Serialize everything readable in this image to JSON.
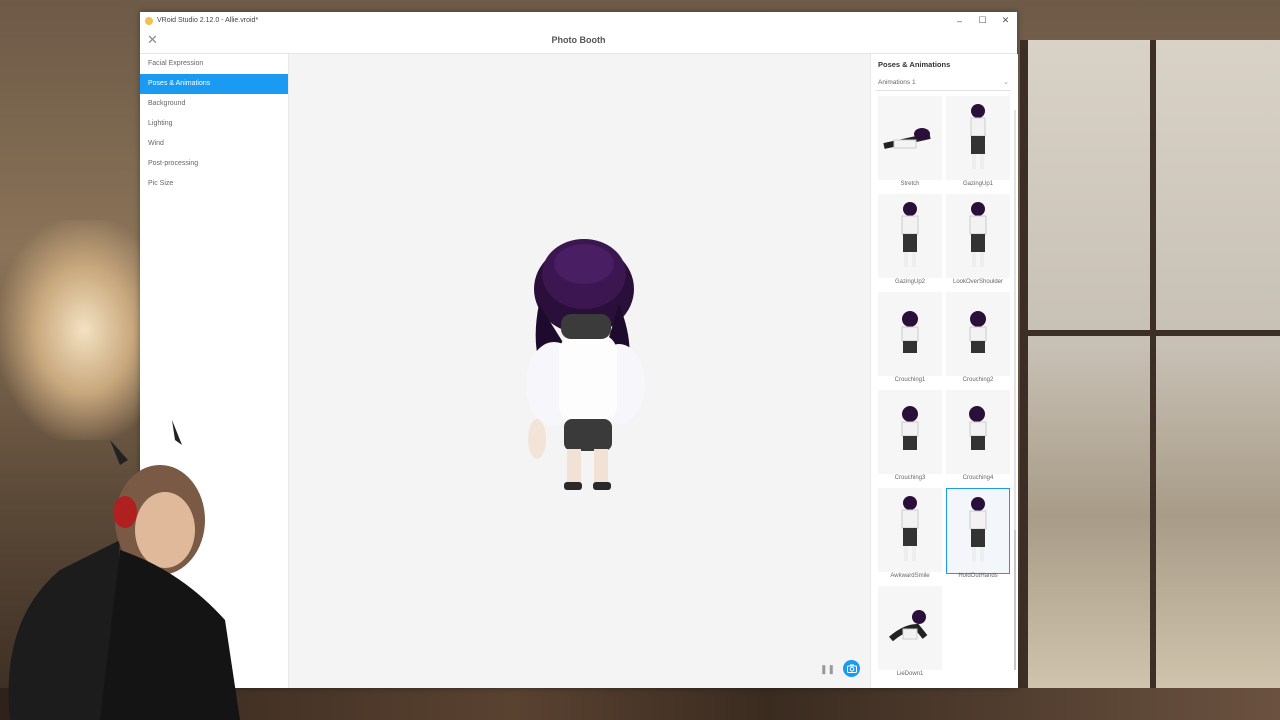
{
  "window": {
    "title": "VRoid Studio 2.12.0 - Allie.vroid*",
    "controls": [
      "–",
      "☐",
      "✕"
    ]
  },
  "header": {
    "title": "Photo Booth",
    "close_icon": "close-icon"
  },
  "left_nav": {
    "items": [
      {
        "label": "Facial Expression",
        "active": false
      },
      {
        "label": "Poses & Animations",
        "active": true
      },
      {
        "label": "Background",
        "active": false
      },
      {
        "label": "Lighting",
        "active": false
      },
      {
        "label": "Wind",
        "active": false
      },
      {
        "label": "Post-processing",
        "active": false
      },
      {
        "label": "Pic Size",
        "active": false
      }
    ]
  },
  "panel": {
    "title": "Poses & Animations",
    "dropdown_value": "Animations 1",
    "animations": [
      {
        "label": "Stretch",
        "selected": false
      },
      {
        "label": "GazingUp1",
        "selected": false
      },
      {
        "label": "GazingUp2",
        "selected": false
      },
      {
        "label": "LookOverShoulder",
        "selected": false
      },
      {
        "label": "Crouching1",
        "selected": false
      },
      {
        "label": "Crouching2",
        "selected": false
      },
      {
        "label": "Crouching3",
        "selected": false
      },
      {
        "label": "Crouching4",
        "selected": false
      },
      {
        "label": "AwkwardSmile",
        "selected": false
      },
      {
        "label": "HoldOutHands",
        "selected": true
      },
      {
        "label": "LieDown1",
        "selected": false
      }
    ]
  },
  "viewport": {
    "pause_label": "❚❚"
  },
  "colors": {
    "accent": "#1a9af0"
  }
}
